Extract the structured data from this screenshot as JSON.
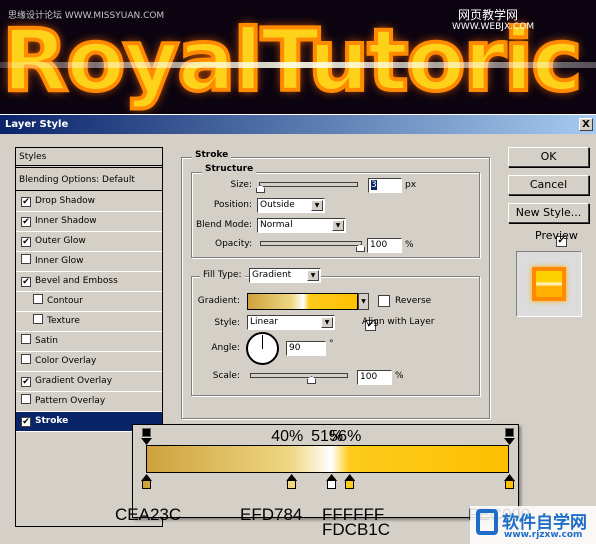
{
  "banner": {
    "text": "RoyalTutoric",
    "watermark_left": "思缘设计论坛 WWW.MISSYUAN.COM",
    "watermark_right_1": "网页教学网",
    "watermark_right_2": "WWW.WEBJX.COM"
  },
  "dialog": {
    "title": "Layer Style",
    "close": "X"
  },
  "styles": {
    "header": "Styles",
    "blending": "Blending Options: Default",
    "items": [
      {
        "label": "Drop Shadow",
        "checked": true,
        "indent": false
      },
      {
        "label": "Inner Shadow",
        "checked": true,
        "indent": false
      },
      {
        "label": "Outer Glow",
        "checked": true,
        "indent": false
      },
      {
        "label": "Inner Glow",
        "checked": false,
        "indent": false
      },
      {
        "label": "Bevel and Emboss",
        "checked": true,
        "indent": false
      },
      {
        "label": "Contour",
        "checked": false,
        "indent": true
      },
      {
        "label": "Texture",
        "checked": false,
        "indent": true
      },
      {
        "label": "Satin",
        "checked": false,
        "indent": false
      },
      {
        "label": "Color Overlay",
        "checked": false,
        "indent": false
      },
      {
        "label": "Gradient Overlay",
        "checked": true,
        "indent": false
      },
      {
        "label": "Pattern Overlay",
        "checked": false,
        "indent": false
      },
      {
        "label": "Stroke",
        "checked": true,
        "indent": false,
        "selected": true
      }
    ]
  },
  "stroke": {
    "title": "Stroke",
    "structure": {
      "title": "Structure",
      "size_label": "Size:",
      "size_value": "3",
      "size_unit": "px",
      "position_label": "Position:",
      "position_value": "Outside",
      "blend_label": "Blend Mode:",
      "blend_value": "Normal",
      "opacity_label": "Opacity:",
      "opacity_value": "100",
      "opacity_unit": "%"
    },
    "fill": {
      "type_label": "Fill Type:",
      "type_value": "Gradient",
      "gradient_label": "Gradient:",
      "reverse_label": "Reverse",
      "reverse_checked": false,
      "style_label": "Style:",
      "style_value": "Linear",
      "align_label": "Align with Layer",
      "align_checked": true,
      "angle_label": "Angle:",
      "angle_value": "90",
      "angle_unit": "°",
      "scale_label": "Scale:",
      "scale_value": "100",
      "scale_unit": "%"
    }
  },
  "buttons": {
    "ok": "OK",
    "cancel": "Cancel",
    "new_style": "New Style...",
    "preview_label": "Preview",
    "preview_checked": true
  },
  "gradient_editor": {
    "midpoints": [
      "40%",
      "51%",
      "56%"
    ],
    "stops": [
      {
        "pos": 0,
        "color": "#CEA23C"
      },
      {
        "pos": 40,
        "color": "#EFD784"
      },
      {
        "pos": 51,
        "color": "#FFFFFF"
      },
      {
        "pos": 56,
        "color": "#FDCB1C"
      },
      {
        "pos": 100,
        "color": "#FEC000"
      }
    ],
    "labels": [
      "CEA23C",
      "EFD784",
      "FFFFFF",
      "FDCB1C",
      "FEC000"
    ]
  },
  "watermark": {
    "logo": "软件自学网",
    "url": "www.rjzxw.com"
  }
}
